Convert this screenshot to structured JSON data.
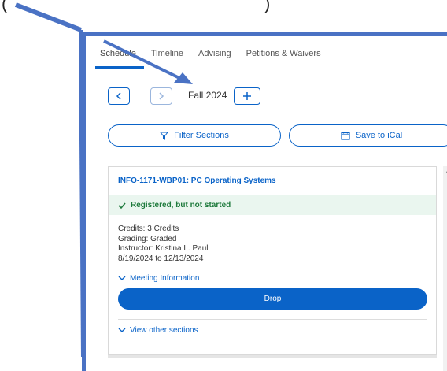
{
  "tabs": [
    {
      "label": "Schedule"
    },
    {
      "label": "Timeline"
    },
    {
      "label": "Advising"
    },
    {
      "label": "Petitions & Waivers"
    }
  ],
  "term": {
    "label": "Fall 2024"
  },
  "actions": {
    "filter_label": "Filter Sections",
    "ical_label": "Save to iCal"
  },
  "course": {
    "title": "INFO-1171-WBP01: PC Operating Systems",
    "status": "Registered, but not started",
    "credits": "Credits: 3 Credits",
    "grading": "Grading: Graded",
    "instructor": "Instructor: Kristina L. Paul",
    "dates": "8/19/2024 to 12/13/2024",
    "meeting_label": "Meeting Information",
    "drop_label": "Drop",
    "other_sections_label": "View other sections"
  },
  "colors": {
    "accent": "#0a63c8",
    "success": "#1e7a3c",
    "annotation": "#4a72c4"
  },
  "icons": [
    "chevron-left-icon",
    "chevron-right-icon",
    "plus-icon",
    "filter-icon",
    "calendar-icon",
    "check-icon",
    "chevron-down-icon",
    "scroll-up-icon",
    "arrow-annotation"
  ]
}
